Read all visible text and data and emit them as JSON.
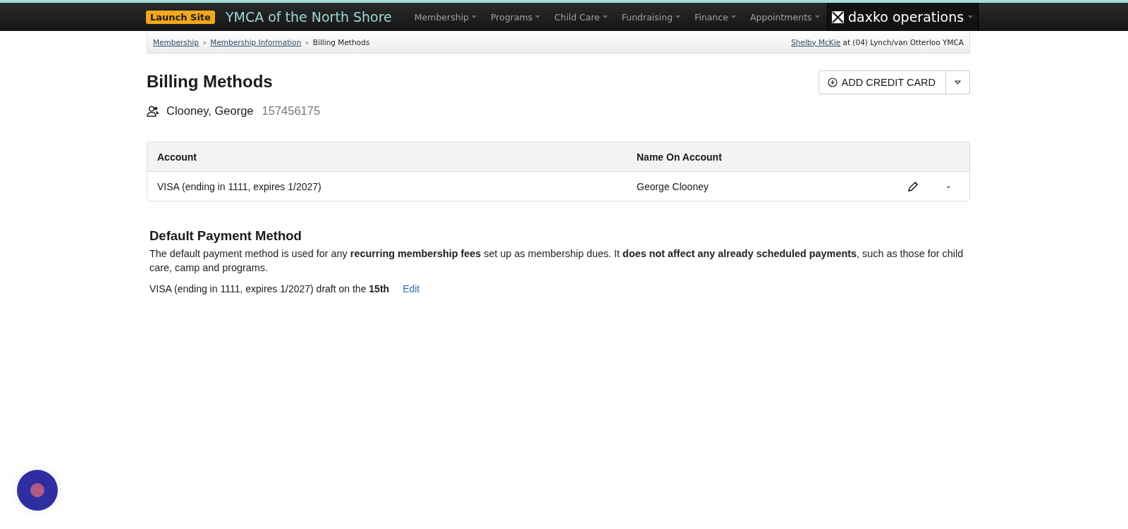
{
  "navbar": {
    "launch_button": "Launch Site",
    "site_title": "YMCA of the North Shore",
    "menus": [
      {
        "label": "Membership"
      },
      {
        "label": "Programs"
      },
      {
        "label": "Child Care"
      },
      {
        "label": "Fundraising"
      },
      {
        "label": "Finance"
      },
      {
        "label": "Appointments"
      }
    ],
    "product": "daxko operations"
  },
  "breadcrumb": {
    "items": [
      {
        "label": "Membership",
        "link": true
      },
      {
        "label": "Membership Information",
        "link": true
      },
      {
        "label": "Billing Methods",
        "link": false
      }
    ],
    "separator": "»",
    "user": "Shelby McKie",
    "location": "at (04) Lynch/van Otterloo YMCA"
  },
  "page_title": "Billing Methods",
  "member": {
    "name": "Clooney, George",
    "id": "157456175"
  },
  "add_button": "ADD CREDIT CARD",
  "table": {
    "columns": [
      "Account",
      "Name On Account"
    ],
    "rows": [
      {
        "account": "VISA (ending in 1111, expires 1/2027)",
        "name": "George Clooney",
        "remove": "-"
      }
    ]
  },
  "default_payment": {
    "title": "Default Payment Method",
    "description": "The default payment method is used for any **recurring membership fees** set up as membership dues. It **does not affect any already scheduled payments**, such as those for child care, camp and programs.",
    "current": "VISA (ending in 1111, expires 1/2027) draft on the **15th**",
    "edit_link": "Edit"
  }
}
